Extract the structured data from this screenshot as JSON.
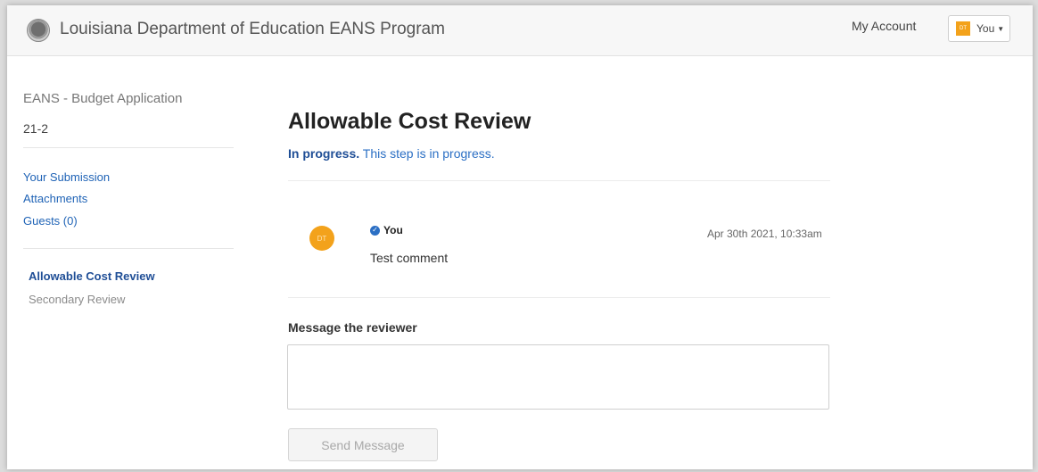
{
  "header": {
    "app_title": "Louisiana Department of Education EANS Program",
    "my_account": "My Account",
    "user_initials": "DT",
    "user_label": "You"
  },
  "sidebar": {
    "title": "EANS - Budget Application",
    "subtitle": "21-2",
    "links": [
      {
        "label": "Your Submission"
      },
      {
        "label": "Attachments"
      },
      {
        "label": "Guests (0)"
      }
    ],
    "steps": [
      {
        "label": "Allowable Cost Review",
        "active": true
      },
      {
        "label": "Secondary Review",
        "active": false
      }
    ]
  },
  "main": {
    "title": "Allowable Cost Review",
    "status_strong": "In progress.",
    "status_text": "This step is in progress.",
    "comment": {
      "avatar_initials": "DT",
      "author": "You",
      "timestamp": "Apr 30th 2021, 10:33am",
      "text": "Test comment"
    },
    "message_label": "Message the reviewer",
    "message_value": "",
    "send_button": "Send Message"
  },
  "colors": {
    "link": "#1f63b6",
    "active_step": "#1f4e96",
    "avatar": "#f3a21b"
  }
}
